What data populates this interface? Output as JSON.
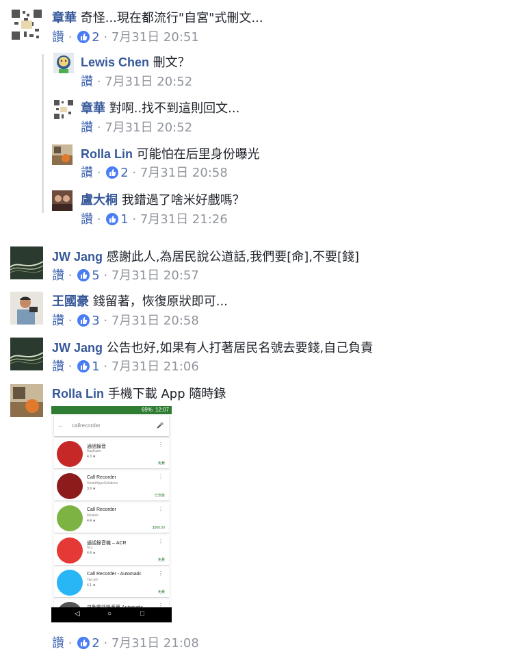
{
  "common": {
    "like": "讚",
    "dot": "·"
  },
  "comments": [
    {
      "author": "章華",
      "text": "奇怪...現在都流行\"自宮\"式刪文...",
      "count": "2",
      "time": "7月31日 20:51"
    },
    {
      "author": "Lewis Chen",
      "text": "刪文？",
      "time": "7月31日 20:52"
    },
    {
      "author": "章華",
      "text": "對啊..找不到這則回文...",
      "time": "7月31日 20:52"
    },
    {
      "author": "Rolla Lin",
      "text": "可能怕在后里身份曝光",
      "count": "2",
      "time": "7月31日 20:58"
    },
    {
      "author": "盧大桐",
      "text": "我錯過了啥米好戲嗎？",
      "count": "1",
      "time": "7月31日 21:26"
    },
    {
      "author": "JW Jang",
      "text": "感謝此人,為居民說公道話,我們要[命],不要[錢]",
      "count": "5",
      "time": "7月31日 20:57"
    },
    {
      "author": "王國豪",
      "text": "錢留著，恢復原狀即可...",
      "count": "3",
      "time": "7月31日 20:58"
    },
    {
      "author": "JW Jang",
      "text": "公告也好,如果有人打著居民名號去要錢,自己負責",
      "count": "1",
      "time": "7月31日 21:06"
    },
    {
      "author": "Rolla Lin",
      "text": "手機下載 App 隨時錄",
      "count": "2",
      "time": "7月31日 21:08"
    }
  ],
  "screenshot": {
    "status_time": "12:07",
    "status_batt": "69%",
    "search_query": "callrecorder",
    "apps": [
      {
        "name": "通話錄音",
        "dev": "Appliqato",
        "rating": "4.3 ★",
        "price": "免費",
        "color": "#c62828"
      },
      {
        "name": "Call Recorder",
        "dev": "SmartAppsSolutions",
        "rating": "3.9 ★",
        "price": "已安裝",
        "color": "#8e1b1b"
      },
      {
        "name": "Call Recorder",
        "dev": "skvalex",
        "rating": "4.4 ★",
        "price": "$300.00",
        "color": "#7cb342"
      },
      {
        "name": "通話錄音機 – ACR",
        "dev": "NLL",
        "rating": "4.4 ★",
        "price": "免費",
        "color": "#e53935"
      },
      {
        "name": "Call Recorder - Automatic",
        "dev": "Tap.pm",
        "rating": "4.1 ★",
        "price": "免費",
        "color": "#29b6f6"
      },
      {
        "name": "自動電話錄音器 Automatic",
        "dev": "",
        "rating": "",
        "price": "",
        "color": "#555555"
      }
    ],
    "nav": {
      "back": "◁",
      "home": "○",
      "recent": "□"
    }
  }
}
